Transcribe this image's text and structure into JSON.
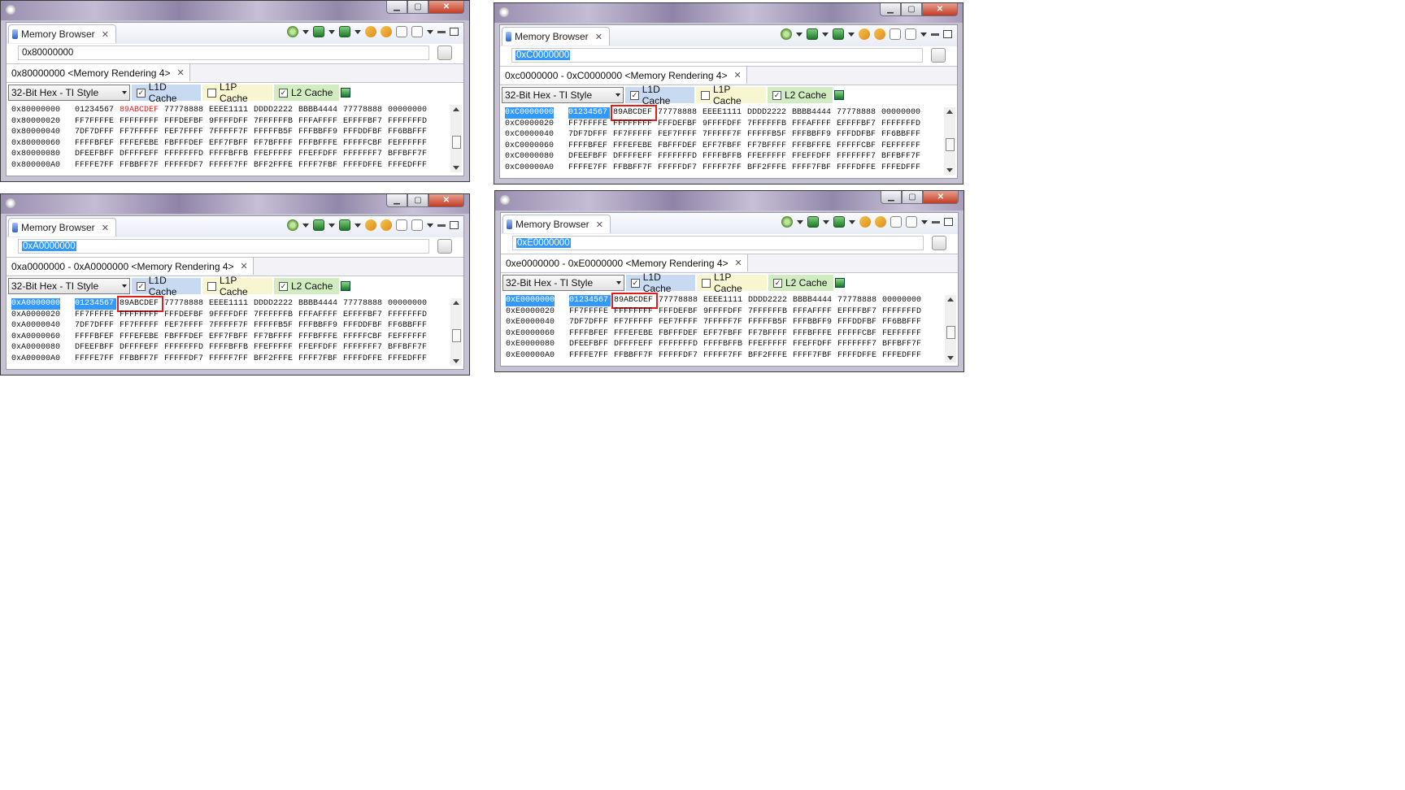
{
  "windows": [
    {
      "id": "w1",
      "view_title": "Memory Browser",
      "address": "0x80000000",
      "address_selected": false,
      "render_tab": "0x80000000 <Memory Rendering 4>",
      "format": "32-Bit Hex - TI Style",
      "caches": [
        {
          "label": "L1D Cache",
          "checked": true
        },
        {
          "label": "L1P Cache",
          "checked": false
        },
        {
          "label": "L2 Cache",
          "checked": true
        }
      ],
      "rows": [
        {
          "addr": "0x80000000",
          "words": [
            "01234567",
            "89ABCDEF",
            "77778888",
            "EEEE1111",
            "DDDD2222",
            "BBBB4444",
            "77778888",
            "00000000"
          ]
        },
        {
          "addr": "0x80000020",
          "words": [
            "FF7FFFFE",
            "FFFFFFFF",
            "FFFDEFBF",
            "9FFFFDFF",
            "7FFFFFFB",
            "FFFAFFFF",
            "EFFFFBF7",
            "FFFFFFFD"
          ]
        },
        {
          "addr": "0x80000040",
          "words": [
            "7DF7DFFF",
            "FF7FFFFF",
            "FEF7FFFF",
            "7FFFFF7F",
            "FFFFFB5F",
            "FFFBBFF9",
            "FFFDDFBF",
            "FF6BBFFF"
          ]
        },
        {
          "addr": "0x80000060",
          "words": [
            "FFFFBFEF",
            "FFFEFEBE",
            "FBFFFDEF",
            "EFF7FBFF",
            "FF7BFFFF",
            "FFFBFFFE",
            "FFFFFCBF",
            "FEFFFFFF"
          ]
        },
        {
          "addr": "0x80000080",
          "words": [
            "DFEEFBFF",
            "DFFFFEFF",
            "FFFFFFFD",
            "FFFFBFFB",
            "FFEFFFFF",
            "FFEFFDFF",
            "FFFFFFF7",
            "BFFBFF7F"
          ]
        },
        {
          "addr": "0x800000A0",
          "words": [
            "FFFFE7FF",
            "FFBBFF7F",
            "FFFFFDF7",
            "FFFFF7FF",
            "BFF2FFFE",
            "FFFF7FBF",
            "FFFFDFFE",
            "FFFEDFFF"
          ]
        }
      ]
    },
    {
      "id": "w2",
      "view_title": "Memory Browser",
      "address": "0xA0000000",
      "address_selected": true,
      "render_tab": "0xa0000000 - 0xA0000000 <Memory Rendering 4>",
      "format": "32-Bit Hex - TI Style",
      "caches": [
        {
          "label": "L1D Cache",
          "checked": true
        },
        {
          "label": "L1P Cache",
          "checked": false
        },
        {
          "label": "L2 Cache",
          "checked": true
        }
      ],
      "rows": [
        {
          "addr": "0xA0000000",
          "words": [
            "01234567",
            "89ABCDEF",
            "77778888",
            "EEEE1111",
            "DDDD2222",
            "BBBB4444",
            "77778888",
            "00000000"
          ]
        },
        {
          "addr": "0xA0000020",
          "words": [
            "FF7FFFFE",
            "FFFFFFFF",
            "FFFDEFBF",
            "9FFFFDFF",
            "7FFFFFFB",
            "FFFAFFFF",
            "EFFFFBF7",
            "FFFFFFFD"
          ]
        },
        {
          "addr": "0xA0000040",
          "words": [
            "7DF7DFFF",
            "FF7FFFFF",
            "FEF7FFFF",
            "7FFFFF7F",
            "FFFFFB5F",
            "FFFBBFF9",
            "FFFDDFBF",
            "FF6BBFFF"
          ]
        },
        {
          "addr": "0xA0000060",
          "words": [
            "FFFFBFEF",
            "FFFEFEBE",
            "FBFFFDEF",
            "EFF7FBFF",
            "FF7BFFFF",
            "FFFBFFFE",
            "FFFFFCBF",
            "FEFFFFFF"
          ]
        },
        {
          "addr": "0xA0000080",
          "words": [
            "DFEEFBFF",
            "DFFFFEFF",
            "FFFFFFFD",
            "FFFFBFFB",
            "FFEFFFFF",
            "FFEFFDFF",
            "FFFFFFF7",
            "BFFBFF7F"
          ]
        },
        {
          "addr": "0xA00000A0",
          "words": [
            "FFFFE7FF",
            "FFBBFF7F",
            "FFFFFDF7",
            "FFFFF7FF",
            "BFF2FFFE",
            "FFFF7FBF",
            "FFFFDFFE",
            "FFFEDFFF"
          ]
        }
      ]
    },
    {
      "id": "w3",
      "view_title": "Memory Browser",
      "address": "0xC0000000",
      "address_selected": true,
      "render_tab": "0xc0000000 - 0xC0000000 <Memory Rendering 4>",
      "format": "32-Bit Hex - TI Style",
      "caches": [
        {
          "label": "L1D Cache",
          "checked": true
        },
        {
          "label": "L1P Cache",
          "checked": false
        },
        {
          "label": "L2 Cache",
          "checked": true
        }
      ],
      "rows": [
        {
          "addr": "0xC0000000",
          "words": [
            "01234567",
            "89ABCDEF",
            "77778888",
            "EEEE1111",
            "DDDD2222",
            "BBBB4444",
            "77778888",
            "00000000"
          ]
        },
        {
          "addr": "0xC0000020",
          "words": [
            "FF7FFFFE",
            "FFFFFFFF",
            "FFFDEFBF",
            "9FFFFDFF",
            "7FFFFFFB",
            "FFFAFFFF",
            "EFFFFBF7",
            "FFFFFFFD"
          ]
        },
        {
          "addr": "0xC0000040",
          "words": [
            "7DF7DFFF",
            "FF7FFFFF",
            "FEF7FFFF",
            "7FFFFF7F",
            "FFFFFB5F",
            "FFFBBFF9",
            "FFFDDFBF",
            "FF6BBFFF"
          ]
        },
        {
          "addr": "0xC0000060",
          "words": [
            "FFFFBFEF",
            "FFFEFEBE",
            "FBFFFDEF",
            "EFF7FBFF",
            "FF7BFFFF",
            "FFFBFFFE",
            "FFFFFCBF",
            "FEFFFFFF"
          ]
        },
        {
          "addr": "0xC0000080",
          "words": [
            "DFEEFBFF",
            "DFFFFEFF",
            "FFFFFFFD",
            "FFFFBFFB",
            "FFEFFFFF",
            "FFEFFDFF",
            "FFFFFFF7",
            "BFFBFF7F"
          ]
        },
        {
          "addr": "0xC00000A0",
          "words": [
            "FFFFE7FF",
            "FFBBFF7F",
            "FFFFFDF7",
            "FFFFF7FF",
            "BFF2FFFE",
            "FFFF7FBF",
            "FFFFDFFE",
            "FFFEDFFF"
          ]
        }
      ]
    },
    {
      "id": "w4",
      "view_title": "Memory Browser",
      "address": "0xE0000000",
      "address_selected": true,
      "render_tab": "0xe0000000 - 0xE0000000 <Memory Rendering 4>",
      "format": "32-Bit Hex - TI Style",
      "caches": [
        {
          "label": "L1D Cache",
          "checked": true
        },
        {
          "label": "L1P Cache",
          "checked": false
        },
        {
          "label": "L2 Cache",
          "checked": true
        }
      ],
      "rows": [
        {
          "addr": "0xE0000000",
          "words": [
            "01234567",
            "89ABCDEF",
            "77778888",
            "EEEE1111",
            "DDDD2222",
            "BBBB4444",
            "77778888",
            "00000000"
          ]
        },
        {
          "addr": "0xE0000020",
          "words": [
            "FF7FFFFE",
            "FFFFFFFF",
            "FFFDEFBF",
            "9FFFFDFF",
            "7FFFFFFB",
            "FFFAFFFF",
            "EFFFFBF7",
            "FFFFFFFD"
          ]
        },
        {
          "addr": "0xE0000040",
          "words": [
            "7DF7DFFF",
            "FF7FFFFF",
            "FEF7FFFF",
            "7FFFFF7F",
            "FFFFFB5F",
            "FFFBBFF9",
            "FFFDDFBF",
            "FF6BBFFF"
          ]
        },
        {
          "addr": "0xE0000060",
          "words": [
            "FFFFBFEF",
            "FFFEFEBE",
            "FBFFFDEF",
            "EFF7FBFF",
            "FF7BFFFF",
            "FFFBFFFE",
            "FFFFFCBF",
            "FEFFFFFF"
          ]
        },
        {
          "addr": "0xE0000080",
          "words": [
            "DFEEFBFF",
            "DFFFFEFF",
            "FFFFFFFD",
            "FFFFBFFB",
            "FFEFFFFF",
            "FFEFFDFF",
            "FFFFFFF7",
            "BFFBFF7F"
          ]
        },
        {
          "addr": "0xE00000A0",
          "words": [
            "FFFFE7FF",
            "FFBBFF7F",
            "FFFFFDF7",
            "FFFFF7FF",
            "BFF2FFFE",
            "FFFF7FBF",
            "FFFFDFFE",
            "FFFEDFFF"
          ]
        }
      ]
    }
  ],
  "colors": {
    "selection": "#3399ff",
    "highlight_box": "#e31c1c",
    "changed_value": "#e02020",
    "l1d": "#c8daf2",
    "l1p": "#f8f6d0",
    "l2": "#d2ecc2"
  }
}
